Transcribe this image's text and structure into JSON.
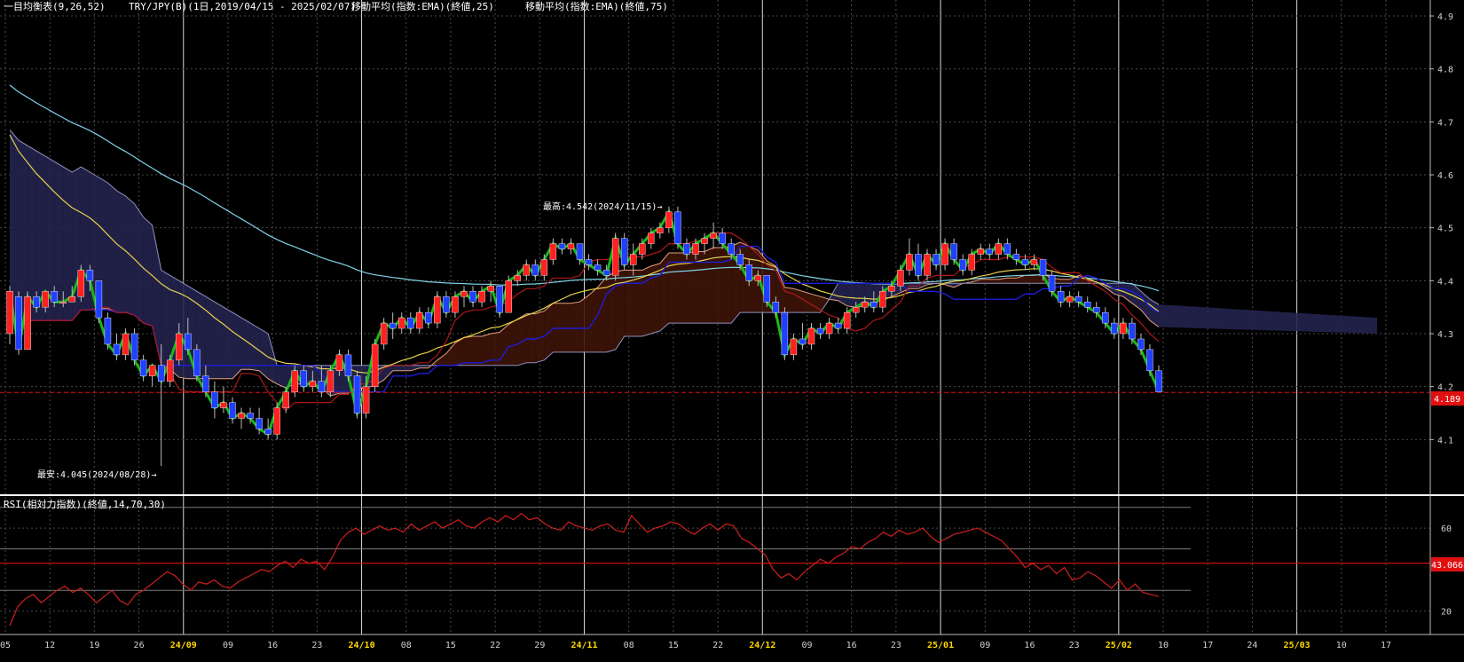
{
  "header": {
    "ichimoku": "一目均衡表(9,26,52)",
    "symbol": "TRY/JPY(B)(1日,2019/04/15 - 2025/02/07)",
    "ema25": "移動平均(指数:EMA)(終値,25)",
    "ema75": "移動平均(指数:EMA)(終値,75)"
  },
  "rsi_label": "RSI(相対力指数)(終値,14,70,30)",
  "annotations": {
    "high": "最高:4.542(2024/11/15)→",
    "low": "最安:4.045(2024/08/28)→"
  },
  "last_price": "4.189",
  "last_rsi": "43.066",
  "colors": {
    "up": "#ff2020",
    "down": "#2040ff",
    "kijun": "#1c1cd8",
    "tenkan": "#b01818",
    "chikou": "#18b818",
    "ema25": "#e6d24a",
    "ema75": "#7fd3e6",
    "cloud_bear": "#23234f",
    "cloud_bull": "#3e1408",
    "rsi": "#d02020"
  },
  "chart_data": [
    {
      "type": "candlestick",
      "x_axis_ticks": [
        "05",
        "12",
        "19",
        "26",
        "24/09",
        "09",
        "16",
        "23",
        "24/10",
        "08",
        "15",
        "22",
        "29",
        "24/11",
        "08",
        "15",
        "22",
        "24/12",
        "09",
        "16",
        "23",
        "25/01",
        "09",
        "16",
        "23",
        "25/02",
        "10",
        "17",
        "24",
        "25/03",
        "10",
        "17"
      ],
      "highlight_ticks": [
        "24/09",
        "24/10",
        "24/11",
        "24/12",
        "25/01",
        "25/02",
        "25/03"
      ],
      "y_ticks": [
        "4.1",
        "4.2",
        "4.3",
        "4.4",
        "4.5",
        "4.6",
        "4.7",
        "4.8",
        "4.9"
      ],
      "ylim": [
        4.0,
        4.9
      ],
      "high": {
        "value": 4.542,
        "date": "2024/11/15"
      },
      "low": {
        "value": 4.045,
        "date": "2024/08/28"
      },
      "last": 4.189,
      "ohlc": [
        [
          4.3,
          4.39,
          4.28,
          4.38
        ],
        [
          4.37,
          4.38,
          4.26,
          4.27
        ],
        [
          4.27,
          4.38,
          4.27,
          4.37
        ],
        [
          4.37,
          4.38,
          4.34,
          4.35
        ],
        [
          4.35,
          4.38,
          4.34,
          4.38
        ],
        [
          4.38,
          4.39,
          4.35,
          4.36
        ],
        [
          4.36,
          4.38,
          4.35,
          4.36
        ],
        [
          4.36,
          4.39,
          4.36,
          4.37
        ],
        [
          4.37,
          4.43,
          4.36,
          4.42
        ],
        [
          4.42,
          4.43,
          4.38,
          4.4
        ],
        [
          4.4,
          4.4,
          4.32,
          4.33
        ],
        [
          4.33,
          4.34,
          4.27,
          4.28
        ],
        [
          4.28,
          4.3,
          4.25,
          4.26
        ],
        [
          4.26,
          4.31,
          4.25,
          4.3
        ],
        [
          4.3,
          4.31,
          4.24,
          4.25
        ],
        [
          4.25,
          4.26,
          4.21,
          4.22
        ],
        [
          4.22,
          4.24,
          4.2,
          4.24
        ],
        [
          4.24,
          4.28,
          4.05,
          4.21
        ],
        [
          4.21,
          4.26,
          4.2,
          4.25
        ],
        [
          4.25,
          4.32,
          4.24,
          4.3
        ],
        [
          4.3,
          4.33,
          4.26,
          4.27
        ],
        [
          4.27,
          4.28,
          4.21,
          4.22
        ],
        [
          4.22,
          4.24,
          4.18,
          4.19
        ],
        [
          4.19,
          4.21,
          4.14,
          4.16
        ],
        [
          4.16,
          4.2,
          4.15,
          4.17
        ],
        [
          4.17,
          4.18,
          4.13,
          4.14
        ],
        [
          4.14,
          4.16,
          4.12,
          4.15
        ],
        [
          4.15,
          4.16,
          4.13,
          4.14
        ],
        [
          4.14,
          4.16,
          4.11,
          4.12
        ],
        [
          4.12,
          4.14,
          4.1,
          4.11
        ],
        [
          4.11,
          4.17,
          4.1,
          4.16
        ],
        [
          4.16,
          4.2,
          4.15,
          4.19
        ],
        [
          4.19,
          4.24,
          4.18,
          4.23
        ],
        [
          4.23,
          4.24,
          4.19,
          4.2
        ],
        [
          4.2,
          4.23,
          4.19,
          4.21
        ],
        [
          4.21,
          4.24,
          4.18,
          4.19
        ],
        [
          4.19,
          4.24,
          4.18,
          4.23
        ],
        [
          4.23,
          4.27,
          4.22,
          4.26
        ],
        [
          4.26,
          4.27,
          4.21,
          4.22
        ],
        [
          4.22,
          4.23,
          4.14,
          4.15
        ],
        [
          4.15,
          4.22,
          4.14,
          4.2
        ],
        [
          4.2,
          4.29,
          4.19,
          4.28
        ],
        [
          4.28,
          4.33,
          4.27,
          4.32
        ],
        [
          4.32,
          4.34,
          4.29,
          4.31
        ],
        [
          4.31,
          4.34,
          4.3,
          4.33
        ],
        [
          4.33,
          4.34,
          4.3,
          4.31
        ],
        [
          4.31,
          4.35,
          4.3,
          4.34
        ],
        [
          4.34,
          4.35,
          4.31,
          4.32
        ],
        [
          4.32,
          4.38,
          4.31,
          4.37
        ],
        [
          4.37,
          4.38,
          4.33,
          4.34
        ],
        [
          4.34,
          4.38,
          4.33,
          4.37
        ],
        [
          4.37,
          4.39,
          4.35,
          4.38
        ],
        [
          4.38,
          4.39,
          4.35,
          4.36
        ],
        [
          4.36,
          4.39,
          4.35,
          4.38
        ],
        [
          4.38,
          4.4,
          4.36,
          4.39
        ],
        [
          4.39,
          4.39,
          4.33,
          4.34
        ],
        [
          4.34,
          4.41,
          4.34,
          4.4
        ],
        [
          4.4,
          4.42,
          4.39,
          4.41
        ],
        [
          4.41,
          4.44,
          4.4,
          4.43
        ],
        [
          4.43,
          4.44,
          4.4,
          4.41
        ],
        [
          4.41,
          4.45,
          4.4,
          4.44
        ],
        [
          4.44,
          4.48,
          4.43,
          4.47
        ],
        [
          4.47,
          4.48,
          4.45,
          4.46
        ],
        [
          4.46,
          4.48,
          4.45,
          4.47
        ],
        [
          4.47,
          4.47,
          4.43,
          4.44
        ],
        [
          4.44,
          4.45,
          4.42,
          4.43
        ],
        [
          4.43,
          4.44,
          4.41,
          4.42
        ],
        [
          4.42,
          4.43,
          4.4,
          4.41
        ],
        [
          4.41,
          4.49,
          4.4,
          4.48
        ],
        [
          4.48,
          4.49,
          4.42,
          4.43
        ],
        [
          4.43,
          4.47,
          4.41,
          4.45
        ],
        [
          4.45,
          4.48,
          4.44,
          4.47
        ],
        [
          4.47,
          4.5,
          4.46,
          4.49
        ],
        [
          4.49,
          4.51,
          4.48,
          4.5
        ],
        [
          4.5,
          4.54,
          4.49,
          4.53
        ],
        [
          4.53,
          4.54,
          4.46,
          4.47
        ],
        [
          4.47,
          4.48,
          4.44,
          4.45
        ],
        [
          4.45,
          4.48,
          4.44,
          4.47
        ],
        [
          4.47,
          4.49,
          4.45,
          4.48
        ],
        [
          4.48,
          4.51,
          4.46,
          4.49
        ],
        [
          4.49,
          4.5,
          4.46,
          4.47
        ],
        [
          4.47,
          4.48,
          4.44,
          4.45
        ],
        [
          4.45,
          4.46,
          4.42,
          4.43
        ],
        [
          4.43,
          4.44,
          4.39,
          4.4
        ],
        [
          4.4,
          4.42,
          4.39,
          4.41
        ],
        [
          4.41,
          4.41,
          4.35,
          4.36
        ],
        [
          4.36,
          4.37,
          4.33,
          4.34
        ],
        [
          4.34,
          4.35,
          4.25,
          4.26
        ],
        [
          4.26,
          4.3,
          4.25,
          4.29
        ],
        [
          4.29,
          4.32,
          4.27,
          4.28
        ],
        [
          4.28,
          4.32,
          4.27,
          4.31
        ],
        [
          4.31,
          4.32,
          4.29,
          4.3
        ],
        [
          4.3,
          4.33,
          4.29,
          4.32
        ],
        [
          4.32,
          4.33,
          4.3,
          4.31
        ],
        [
          4.31,
          4.35,
          4.3,
          4.34
        ],
        [
          4.34,
          4.36,
          4.33,
          4.35
        ],
        [
          4.35,
          4.37,
          4.34,
          4.36
        ],
        [
          4.36,
          4.38,
          4.34,
          4.35
        ],
        [
          4.35,
          4.39,
          4.34,
          4.38
        ],
        [
          4.38,
          4.4,
          4.37,
          4.39
        ],
        [
          4.39,
          4.43,
          4.38,
          4.42
        ],
        [
          4.42,
          4.48,
          4.41,
          4.45
        ],
        [
          4.45,
          4.47,
          4.4,
          4.41
        ],
        [
          4.41,
          4.46,
          4.4,
          4.45
        ],
        [
          4.45,
          4.46,
          4.42,
          4.43
        ],
        [
          4.43,
          4.48,
          4.42,
          4.47
        ],
        [
          4.47,
          4.48,
          4.43,
          4.44
        ],
        [
          4.44,
          4.45,
          4.41,
          4.42
        ],
        [
          4.42,
          4.46,
          4.41,
          4.45
        ],
        [
          4.45,
          4.47,
          4.44,
          4.46
        ],
        [
          4.46,
          4.47,
          4.44,
          4.45
        ],
        [
          4.45,
          4.48,
          4.44,
          4.47
        ],
        [
          4.47,
          4.48,
          4.44,
          4.45
        ],
        [
          4.45,
          4.46,
          4.43,
          4.44
        ],
        [
          4.44,
          4.45,
          4.42,
          4.43
        ],
        [
          4.43,
          4.45,
          4.42,
          4.44
        ],
        [
          4.44,
          4.44,
          4.4,
          4.41
        ],
        [
          4.41,
          4.42,
          4.37,
          4.38
        ],
        [
          4.38,
          4.39,
          4.35,
          4.36
        ],
        [
          4.36,
          4.38,
          4.35,
          4.37
        ],
        [
          4.37,
          4.38,
          4.35,
          4.36
        ],
        [
          4.36,
          4.37,
          4.34,
          4.35
        ],
        [
          4.35,
          4.36,
          4.33,
          4.34
        ],
        [
          4.34,
          4.35,
          4.31,
          4.32
        ],
        [
          4.32,
          4.33,
          4.29,
          4.3
        ],
        [
          4.3,
          4.33,
          4.29,
          4.32
        ],
        [
          4.32,
          4.33,
          4.28,
          4.29
        ],
        [
          4.29,
          4.3,
          4.26,
          4.27
        ],
        [
          4.27,
          4.28,
          4.22,
          4.23
        ],
        [
          4.23,
          4.24,
          4.2,
          4.19
        ]
      ]
    },
    {
      "type": "line",
      "title": "RSI(相対力指数)(終値,14,70,30)",
      "y_ticks": [
        "20",
        "60"
      ],
      "ylim": [
        10,
        75
      ],
      "levels": [
        70,
        50,
        30
      ],
      "last": 43.066,
      "values": [
        13,
        22,
        26,
        28,
        24,
        27,
        30,
        32,
        29,
        31,
        28,
        24,
        27,
        30,
        25,
        23,
        28,
        30,
        33,
        36,
        39,
        37,
        33,
        30,
        34,
        33,
        35,
        32,
        31,
        34,
        36,
        38,
        40,
        39,
        42,
        44,
        41,
        45,
        43,
        44,
        40,
        46,
        54,
        58,
        60,
        57,
        59,
        61,
        59,
        60,
        58,
        62,
        59,
        61,
        63,
        60,
        62,
        64,
        61,
        60,
        63,
        65,
        63,
        66,
        64,
        67,
        64,
        65,
        62,
        60,
        59,
        63,
        61,
        60,
        59,
        61,
        62,
        59,
        58,
        66,
        62,
        58,
        60,
        61,
        63,
        62,
        59,
        57,
        60,
        62,
        59,
        62,
        61,
        55,
        53,
        50,
        47,
        40,
        36,
        38,
        35,
        39,
        42,
        45,
        43,
        46,
        48,
        51,
        50,
        53,
        55,
        58,
        56,
        59,
        57,
        58,
        60,
        56,
        53,
        55,
        57,
        58,
        59,
        60,
        58,
        56,
        54,
        50,
        46,
        41,
        43,
        40,
        42,
        38,
        41,
        35,
        36,
        39,
        37,
        34,
        31,
        35,
        30,
        33,
        29,
        28,
        27
      ]
    }
  ]
}
